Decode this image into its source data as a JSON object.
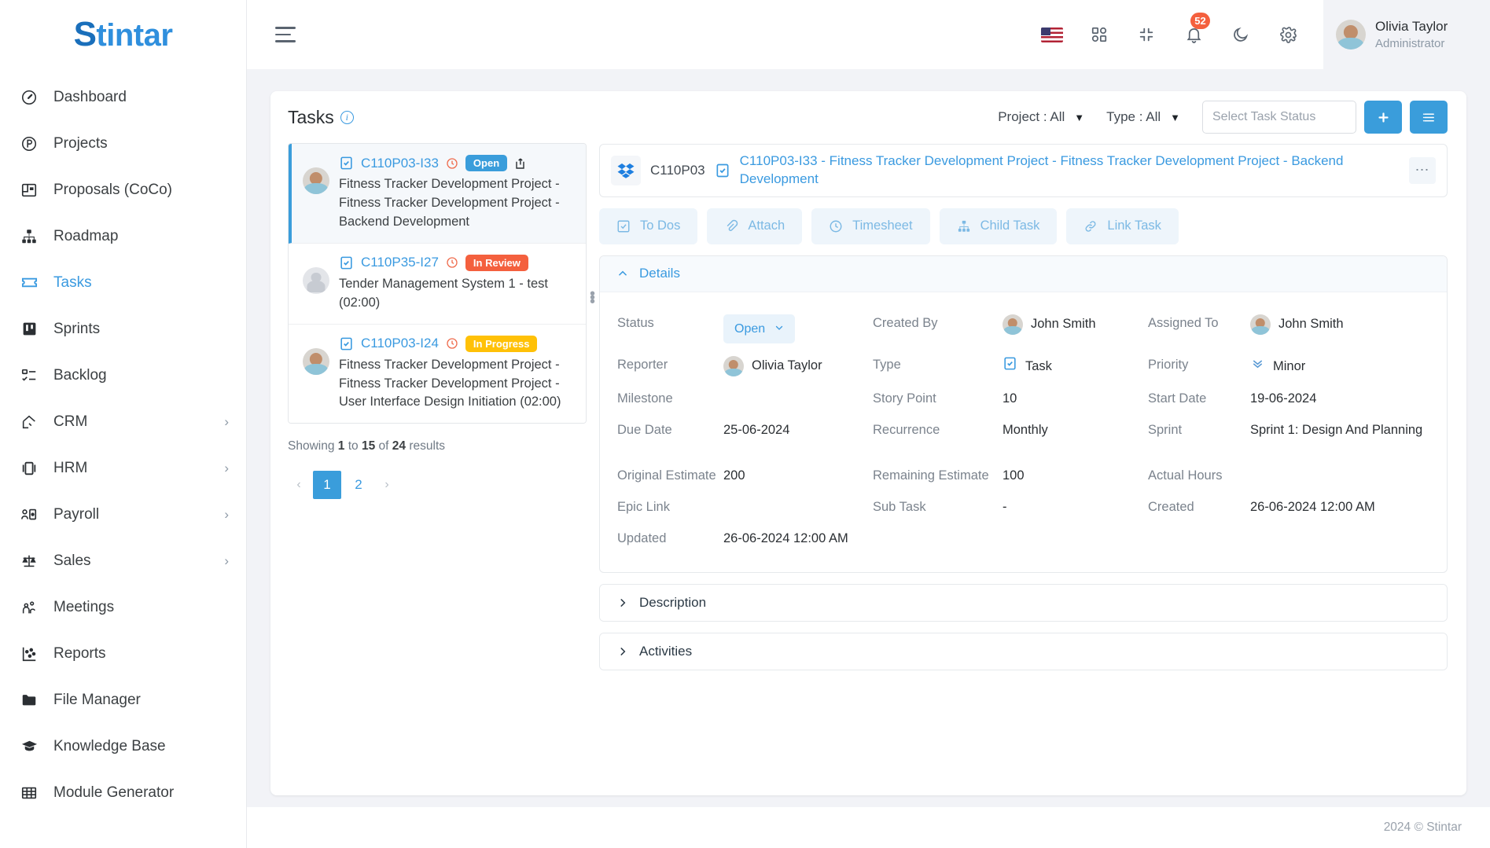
{
  "brand": {
    "first_letter": "S",
    "rest": "tintar"
  },
  "sidebar": {
    "items": [
      {
        "label": "Dashboard",
        "icon": "gauge-icon",
        "active": false,
        "caret": false
      },
      {
        "label": "Projects",
        "icon": "p-circle-icon",
        "active": false,
        "caret": false
      },
      {
        "label": "Proposals (CoCo)",
        "icon": "layout-icon",
        "active": false,
        "caret": false
      },
      {
        "label": "Roadmap",
        "icon": "hierarchy-icon",
        "active": false,
        "caret": false
      },
      {
        "label": "Tasks",
        "icon": "ticket-icon",
        "active": true,
        "caret": false
      },
      {
        "label": "Sprints",
        "icon": "board-icon",
        "active": false,
        "caret": false
      },
      {
        "label": "Backlog",
        "icon": "checklist-icon",
        "active": false,
        "caret": false
      },
      {
        "label": "CRM",
        "icon": "handshake-icon",
        "active": false,
        "caret": true
      },
      {
        "label": "HRM",
        "icon": "id-card-icon",
        "active": false,
        "caret": true
      },
      {
        "label": "Payroll",
        "icon": "money-person-icon",
        "active": false,
        "caret": true
      },
      {
        "label": "Sales",
        "icon": "scale-icon",
        "active": false,
        "caret": true
      },
      {
        "label": "Meetings",
        "icon": "people-icon",
        "active": false,
        "caret": false
      },
      {
        "label": "Reports",
        "icon": "scatter-chart-icon",
        "active": false,
        "caret": false
      },
      {
        "label": "File Manager",
        "icon": "folder-icon",
        "active": false,
        "caret": false
      },
      {
        "label": "Knowledge Base",
        "icon": "graduation-cap-icon",
        "active": false,
        "caret": false
      },
      {
        "label": "Module Generator",
        "icon": "grid-table-icon",
        "active": false,
        "caret": false
      }
    ]
  },
  "topbar": {
    "menu_toggle": "hamburger-icon",
    "language_flag": "us-flag-icon",
    "apps_icon": "apps-grid-icon",
    "fullscreen_icon": "compress-icon",
    "notifications_icon": "bell-icon",
    "notifications_count": "52",
    "theme_icon": "moon-icon",
    "settings_icon": "gear-icon",
    "user": {
      "name": "Olivia Taylor",
      "role": "Administrator"
    }
  },
  "header": {
    "title": "Tasks",
    "info_icon": "info-icon",
    "project_filter": "Project : All",
    "type_filter": "Type : All",
    "status_placeholder": "Select Task Status",
    "add_label": "+",
    "list_label": "≡"
  },
  "tasklist": {
    "rows": [
      {
        "key": "C110P03-I33",
        "status": "Open",
        "status_class": "open",
        "title": "Fitness Tracker Development Project - Fitness Tracker Development Project - Backend Development",
        "selected": true,
        "avatar": "photo",
        "has_share": true
      },
      {
        "key": "C110P35-I27",
        "status": "In Review",
        "status_class": "review",
        "title": "Tender Management System 1 - test (02:00)",
        "selected": false,
        "avatar": "grey",
        "has_share": false
      },
      {
        "key": "C110P03-I24",
        "status": "In Progress",
        "status_class": "progress",
        "title": "Fitness Tracker Development Project - Fitness Tracker Development Project - User Interface Design Initiation (02:00)",
        "selected": false,
        "avatar": "photo",
        "has_share": false
      }
    ],
    "showing_prefix": "Showing",
    "showing_from": "1",
    "showing_mid": "to",
    "showing_to": "15",
    "showing_of": "of",
    "showing_total": "24",
    "showing_suffix": "results",
    "pages": [
      "1",
      "2"
    ],
    "current_page": "1",
    "prev_label": "‹",
    "next_label": "›"
  },
  "detail": {
    "project_key": "C110P03",
    "dropbox_icon": "dropbox-icon",
    "task_type_icon": "task-checkbox-icon",
    "title": "C110P03-I33 - Fitness Tracker Development Project - Fitness Tracker Development Project - Backend Development",
    "more_label": "⋯",
    "tabs": [
      {
        "label": "To Dos",
        "icon": "checkbox-icon"
      },
      {
        "label": "Attach",
        "icon": "paperclip-icon"
      },
      {
        "label": "Timesheet",
        "icon": "clock-icon"
      },
      {
        "label": "Child Task",
        "icon": "hierarchy-icon"
      },
      {
        "label": "Link Task",
        "icon": "link-icon"
      }
    ],
    "details_panel": {
      "title": "Details",
      "expanded": true,
      "fields": [
        {
          "label": "Status",
          "value": "Open",
          "kind": "status"
        },
        {
          "label": "Created By",
          "value": "John Smith",
          "kind": "avatar"
        },
        {
          "label": "Assigned To",
          "value": "John Smith",
          "kind": "avatar"
        },
        {
          "label": "Reporter",
          "value": "Olivia Taylor",
          "kind": "avatar"
        },
        {
          "label": "Type",
          "value": "Task",
          "kind": "task-icon"
        },
        {
          "label": "Priority",
          "value": "Minor",
          "kind": "priority-icon"
        },
        {
          "label": "Milestone",
          "value": "",
          "kind": "text"
        },
        {
          "label": "Story Point",
          "value": "10",
          "kind": "text"
        },
        {
          "label": "Start Date",
          "value": "19-06-2024",
          "kind": "text"
        },
        {
          "label": "Due Date",
          "value": "25-06-2024",
          "kind": "text"
        },
        {
          "label": "Recurrence",
          "value": "Monthly",
          "kind": "text"
        },
        {
          "label": "Sprint",
          "value": "Sprint 1: Design And Planning",
          "kind": "text"
        },
        {
          "label": "Original Estimate",
          "value": "200",
          "kind": "text"
        },
        {
          "label": "Remaining Estimate",
          "value": "100",
          "kind": "text"
        },
        {
          "label": "Actual Hours",
          "value": "",
          "kind": "text"
        },
        {
          "label": "Epic Link",
          "value": "",
          "kind": "text"
        },
        {
          "label": "Sub Task",
          "value": "-",
          "kind": "text"
        },
        {
          "label": "Created",
          "value": "26-06-2024 12:00 AM",
          "kind": "text"
        },
        {
          "label": "Updated",
          "value": "26-06-2024 12:00 AM",
          "kind": "text"
        }
      ]
    },
    "description_panel": {
      "title": "Description",
      "expanded": false
    },
    "activities_panel": {
      "title": "Activities",
      "expanded": false
    }
  },
  "footer": {
    "copyright": "2024 © Stintar"
  },
  "colors": {
    "accent": "#3a9ddb",
    "link": "#3a9ae0",
    "danger": "#f4603e",
    "warning": "#ffc107",
    "page_bg": "#f2f3f7"
  }
}
